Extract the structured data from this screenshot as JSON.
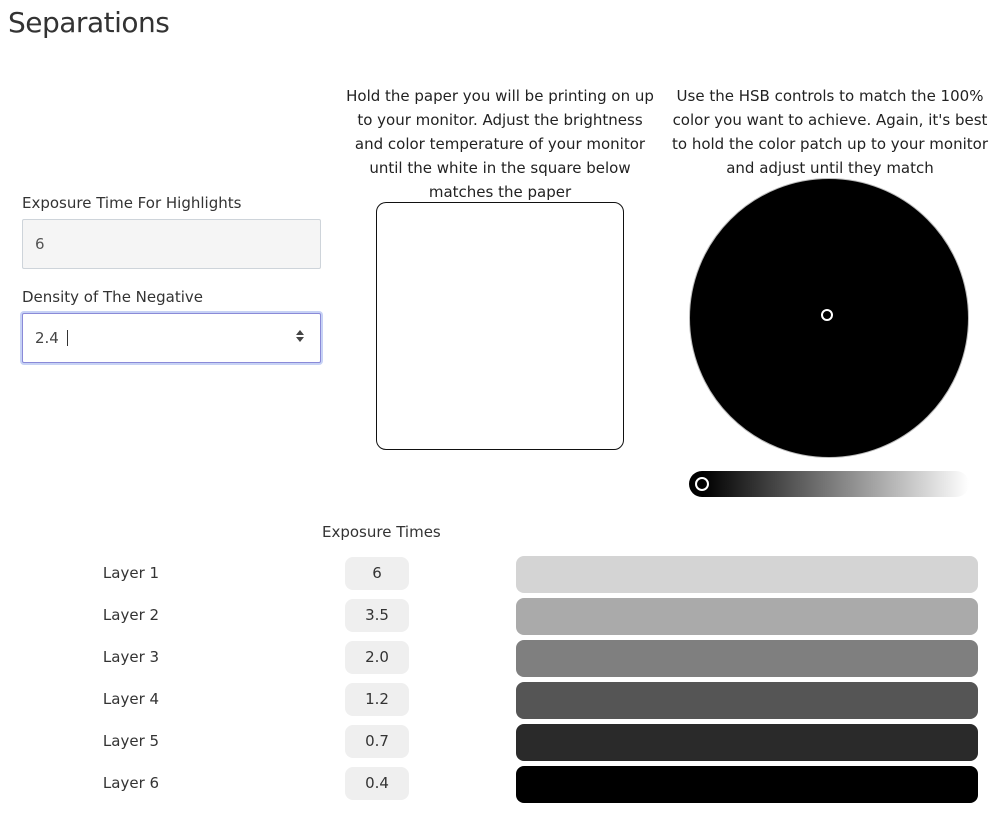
{
  "page": {
    "title": "Separations"
  },
  "form": {
    "highlight_label": "Exposure Time For Highlights",
    "highlight_value": "6",
    "density_label": "Density of The Negative",
    "density_value": "2.4"
  },
  "paper": {
    "instructions": "Hold the paper you will be printing on up to your monitor. Adjust the brightness and color temperature of your monitor until the white in the square below matches the paper"
  },
  "hsb": {
    "instructions": "Use the HSB controls to match the 100% color you want to achieve. Again, it's best to hold the color patch up to your monitor and adjust until they match",
    "brightness_level": 0.02
  },
  "exposure": {
    "title": "Exposure Times",
    "layers": [
      {
        "label": "Layer 1",
        "time": "6",
        "color": "#d4d4d4"
      },
      {
        "label": "Layer 2",
        "time": "3.5",
        "color": "#aaaaaa"
      },
      {
        "label": "Layer 3",
        "time": "2.0",
        "color": "#7f7f7f"
      },
      {
        "label": "Layer 4",
        "time": "1.2",
        "color": "#555555"
      },
      {
        "label": "Layer 5",
        "time": "0.7",
        "color": "#2a2a2a"
      },
      {
        "label": "Layer 6",
        "time": "0.4",
        "color": "#000000"
      }
    ]
  }
}
